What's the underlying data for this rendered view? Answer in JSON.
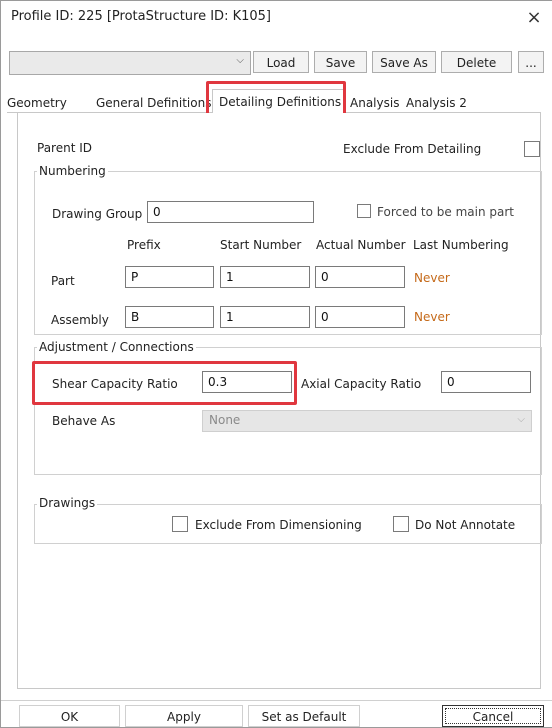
{
  "window": {
    "title": "Profile ID: 225 [ProtaStructure ID: K105]",
    "close_glyph": "×"
  },
  "toolbar": {
    "profile_select_value": "",
    "dropdown_glyph": "⌵",
    "load": "Load",
    "save": "Save",
    "save_as": "Save As",
    "delete": "Delete",
    "more": "..."
  },
  "tabs": [
    "Geometry",
    "General Definitions",
    "Detailing Definitions",
    "Analysis",
    "Analysis 2"
  ],
  "active_tab": "Detailing Definitions",
  "detailing": {
    "parent_id_label": "Parent ID",
    "exclude_from_detailing_label": "Exclude From Detailing",
    "numbering": {
      "legend": "Numbering",
      "drawing_group_label": "Drawing Group",
      "drawing_group_value": "0",
      "forced_main_label": "Forced to be main part",
      "col_prefix": "Prefix",
      "col_start": "Start Number",
      "col_actual": "Actual Number",
      "col_last": "Last Numbering",
      "rows": [
        {
          "label": "Part",
          "prefix": "P",
          "start": "1",
          "actual": "0",
          "last": "Never"
        },
        {
          "label": "Assembly",
          "prefix": "B",
          "start": "1",
          "actual": "0",
          "last": "Never"
        }
      ]
    },
    "adjustment": {
      "legend": "Adjustment / Connections",
      "shear_label": "Shear Capacity Ratio",
      "shear_value": "0.3",
      "axial_label": "Axial Capacity Ratio",
      "axial_value": "0",
      "behave_label": "Behave As",
      "behave_value": "None",
      "behave_glyph": "⌵"
    },
    "drawings": {
      "legend": "Drawings",
      "exclude_dim_label": "Exclude From Dimensioning",
      "do_not_annotate_label": "Do Not Annotate"
    }
  },
  "footer": {
    "ok": "OK",
    "apply": "Apply",
    "set_default": "Set as Default",
    "cancel": "Cancel"
  },
  "colors": {
    "highlight": "#e0373f",
    "never_text": "#c56a1a"
  }
}
